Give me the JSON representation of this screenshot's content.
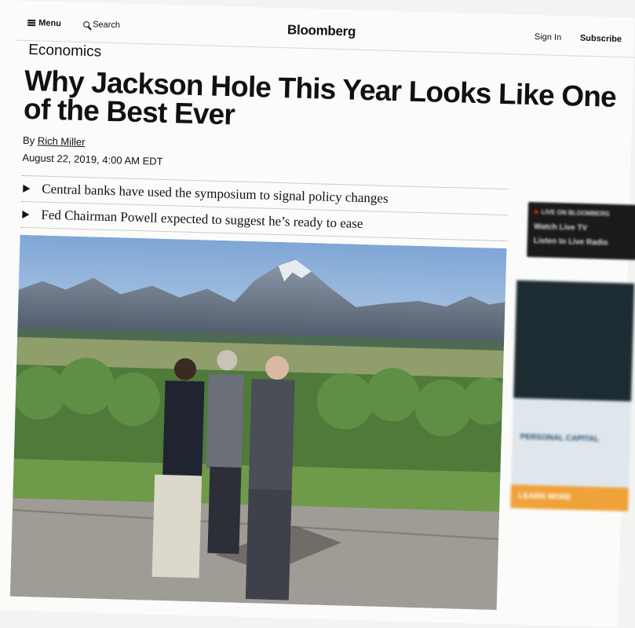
{
  "header": {
    "menu_label": "Menu",
    "search_label": "Search",
    "logo": "Bloomberg",
    "signin_label": "Sign In",
    "subscribe_label": "Subscribe"
  },
  "article": {
    "section": "Economics",
    "headline": "Why Jackson Hole This Year Looks Like One of the Best Ever",
    "byline_prefix": "By",
    "author": "Rich Miller",
    "date": "August 22, 2019, 4:00 AM EDT",
    "bullets": [
      "Central banks have used the symposium to signal policy changes",
      "Fed Chairman Powell expected to suggest he’s ready to ease"
    ]
  },
  "sidebar": {
    "live_label": "LIVE ON BLOOMBERG",
    "watch_label": "Watch Live TV",
    "listen_label": "Listen to Live Radio",
    "ad_brand": "PERSONAL CAPITAL",
    "ad_cta": "LEARN MORE"
  },
  "colors": {
    "live_dot": "#e02020",
    "ad_cta": "#f0a23a",
    "sky": "#8fb3dd"
  },
  "icons": [
    "hamburger-icon",
    "search-icon",
    "bullet-triangle-icon"
  ]
}
